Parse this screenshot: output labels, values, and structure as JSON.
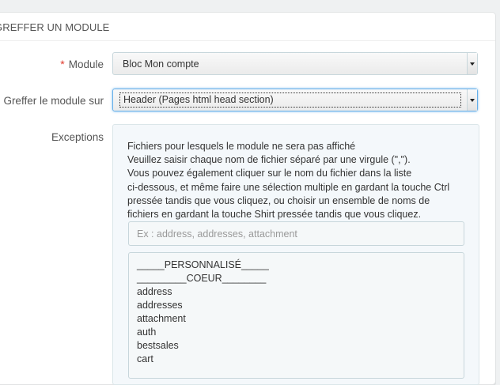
{
  "panel": {
    "title": "GREFFER UN MODULE"
  },
  "module": {
    "required_mark": "*",
    "label": "Module",
    "selected": "Bloc Mon compte"
  },
  "hook": {
    "label": "Greffer le module sur",
    "selected": "Header (Pages html head section)"
  },
  "exceptions": {
    "label": "Exceptions",
    "help_lines": [
      "Fichiers pour lesquels le module ne sera pas affiché",
      "Veuillez saisir chaque nom de fichier séparé par une virgule (\",\").",
      "Vous pouvez également cliquer sur le nom du fichier dans la liste",
      "ci-dessous, et même faire une sélection multiple en gardant la touche Ctrl",
      "pressée tandis que vous cliquez, ou choisir un ensemble de noms de",
      "fichiers en gardant la touche Shirt pressée tandis que vous cliquez."
    ],
    "input_placeholder": "Ex : address, addresses, attachment",
    "files": [
      "_____PERSONNALISÉ_____",
      "_________COEUR________",
      "address",
      "addresses",
      "attachment",
      "auth",
      "bestsales",
      "cart"
    ]
  }
}
